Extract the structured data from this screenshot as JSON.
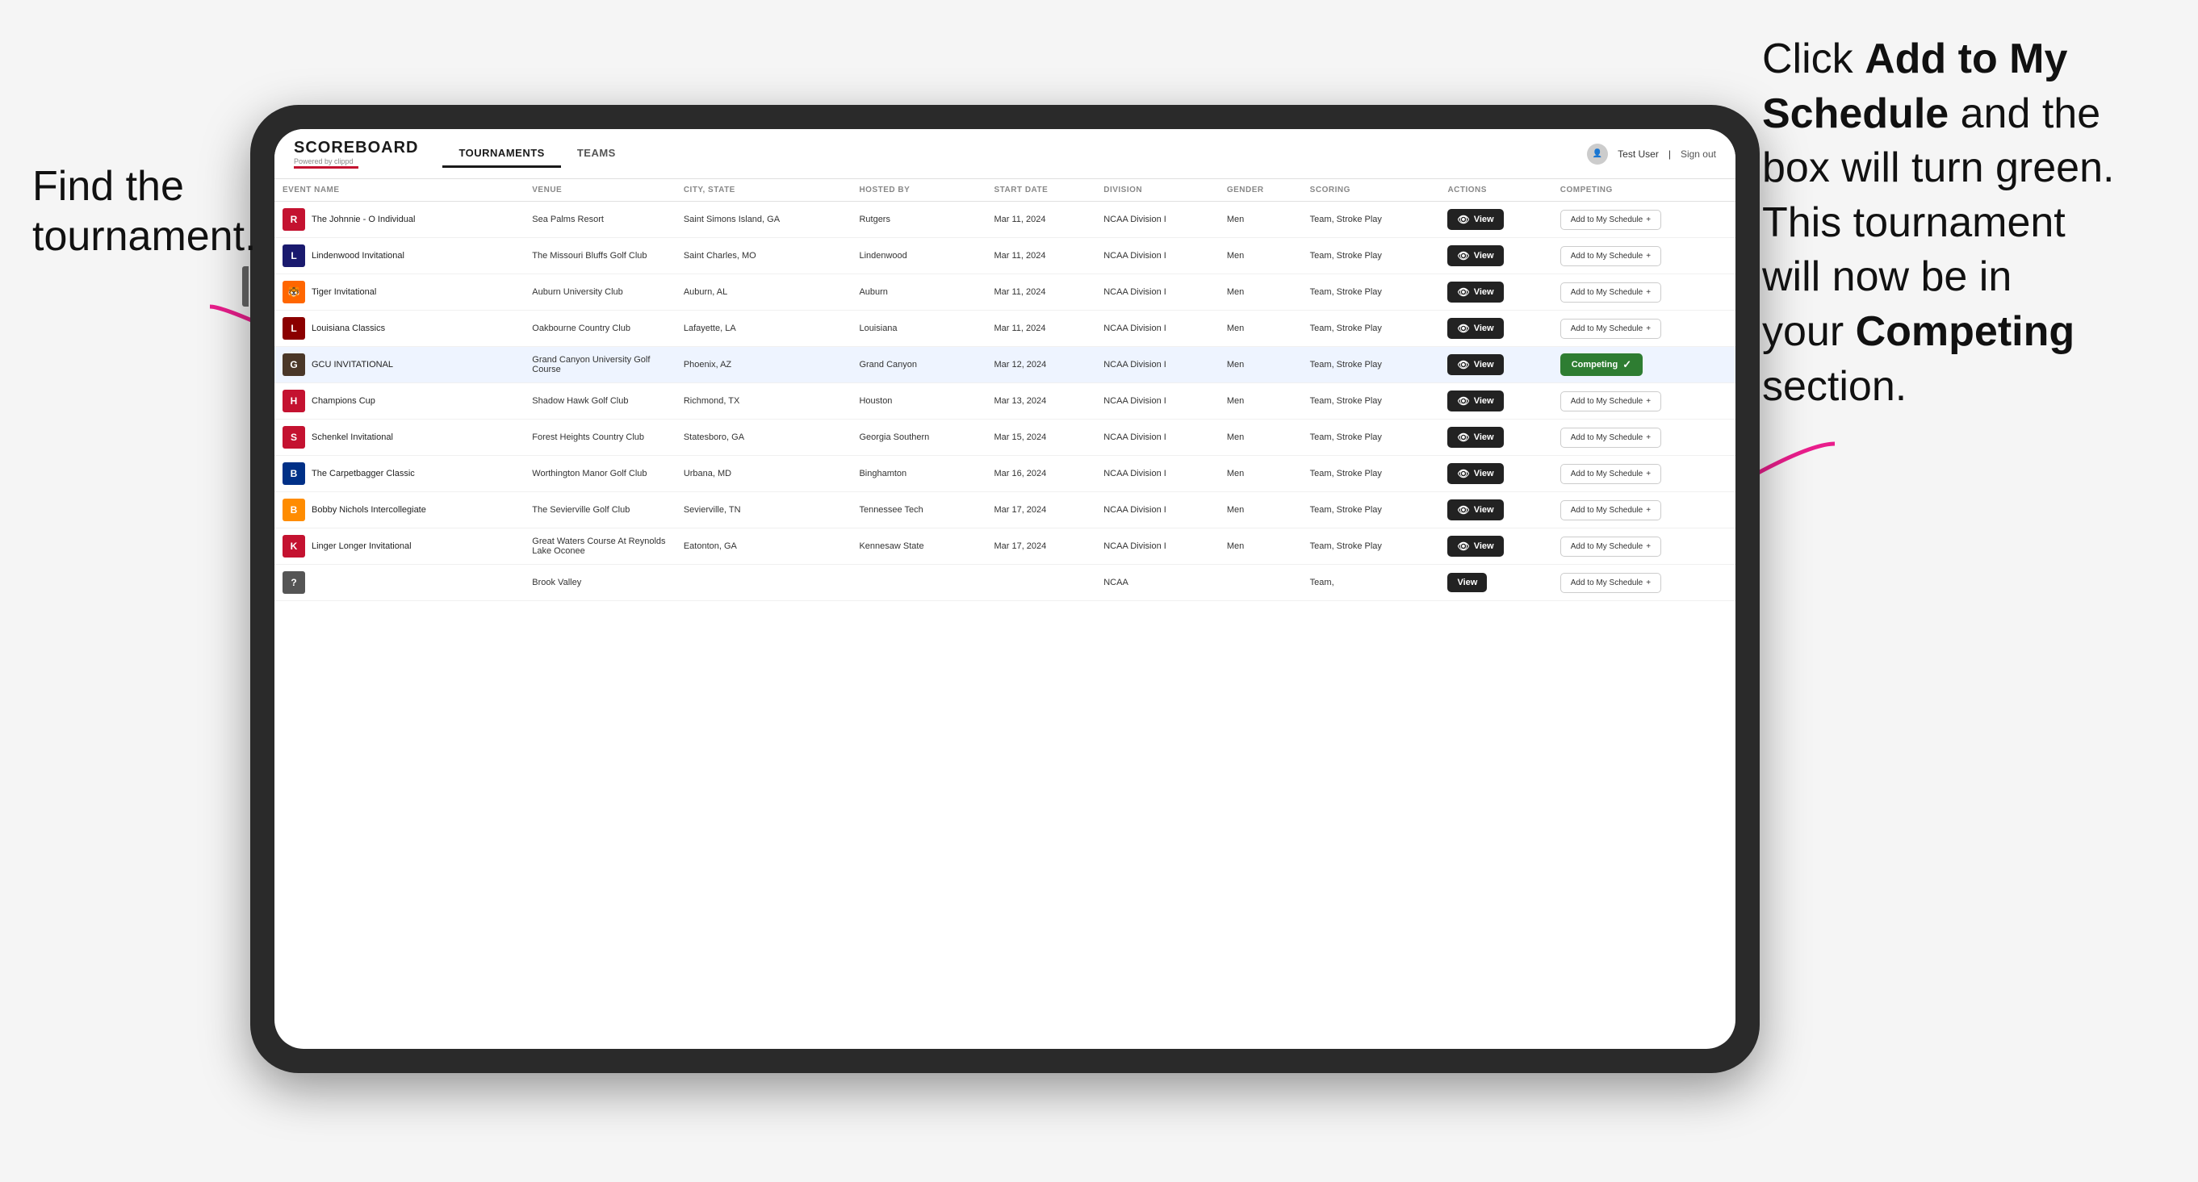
{
  "annotations": {
    "left": "Find the\ntournament.",
    "right_line1": "Click ",
    "right_bold1": "Add to My\nSchedule",
    "right_line2": " and the\nbox will turn green.\nThis tournament\nwill now be in\nyour ",
    "right_bold2": "Competing",
    "right_line3": "\nsection."
  },
  "header": {
    "logo": "SCOREBOARD",
    "logo_sub": "Powered by clippd",
    "nav_tabs": [
      "TOURNAMENTS",
      "TEAMS"
    ],
    "active_tab": "TOURNAMENTS",
    "user_text": "Test User",
    "sign_out": "Sign out"
  },
  "table": {
    "columns": [
      "EVENT NAME",
      "VENUE",
      "CITY, STATE",
      "HOSTED BY",
      "START DATE",
      "DIVISION",
      "GENDER",
      "SCORING",
      "ACTIONS",
      "COMPETING"
    ],
    "rows": [
      {
        "logo_color": "#c41230",
        "logo_letter": "R",
        "event": "The Johnnie - O Individual",
        "venue": "Sea Palms Resort",
        "city_state": "Saint Simons Island, GA",
        "hosted_by": "Rutgers",
        "start_date": "Mar 11, 2024",
        "division": "NCAA Division I",
        "gender": "Men",
        "scoring": "Team, Stroke Play",
        "competing": false,
        "highlighted": false
      },
      {
        "logo_color": "#1a1a6e",
        "logo_letter": "L",
        "event": "Lindenwood Invitational",
        "venue": "The Missouri Bluffs Golf Club",
        "city_state": "Saint Charles, MO",
        "hosted_by": "Lindenwood",
        "start_date": "Mar 11, 2024",
        "division": "NCAA Division I",
        "gender": "Men",
        "scoring": "Team, Stroke Play",
        "competing": false,
        "highlighted": false
      },
      {
        "logo_color": "#FF6600",
        "logo_letter": "🐯",
        "event": "Tiger Invitational",
        "venue": "Auburn University Club",
        "city_state": "Auburn, AL",
        "hosted_by": "Auburn",
        "start_date": "Mar 11, 2024",
        "division": "NCAA Division I",
        "gender": "Men",
        "scoring": "Team, Stroke Play",
        "competing": false,
        "highlighted": false
      },
      {
        "logo_color": "#8B0000",
        "logo_letter": "L",
        "event": "Louisiana Classics",
        "venue": "Oakbourne Country Club",
        "city_state": "Lafayette, LA",
        "hosted_by": "Louisiana",
        "start_date": "Mar 11, 2024",
        "division": "NCAA Division I",
        "gender": "Men",
        "scoring": "Team, Stroke Play",
        "competing": false,
        "highlighted": false
      },
      {
        "logo_color": "#4a3728",
        "logo_letter": "G",
        "event": "GCU INVITATIONAL",
        "venue": "Grand Canyon University Golf Course",
        "city_state": "Phoenix, AZ",
        "hosted_by": "Grand Canyon",
        "start_date": "Mar 12, 2024",
        "division": "NCAA Division I",
        "gender": "Men",
        "scoring": "Team, Stroke Play",
        "competing": true,
        "highlighted": true
      },
      {
        "logo_color": "#c41230",
        "logo_letter": "H",
        "event": "Champions Cup",
        "venue": "Shadow Hawk Golf Club",
        "city_state": "Richmond, TX",
        "hosted_by": "Houston",
        "start_date": "Mar 13, 2024",
        "division": "NCAA Division I",
        "gender": "Men",
        "scoring": "Team, Stroke Play",
        "competing": false,
        "highlighted": false
      },
      {
        "logo_color": "#c41230",
        "logo_letter": "S",
        "event": "Schenkel Invitational",
        "venue": "Forest Heights Country Club",
        "city_state": "Statesboro, GA",
        "hosted_by": "Georgia Southern",
        "start_date": "Mar 15, 2024",
        "division": "NCAA Division I",
        "gender": "Men",
        "scoring": "Team, Stroke Play",
        "competing": false,
        "highlighted": false
      },
      {
        "logo_color": "#003087",
        "logo_letter": "B",
        "event": "The Carpetbagger Classic",
        "venue": "Worthington Manor Golf Club",
        "city_state": "Urbana, MD",
        "hosted_by": "Binghamton",
        "start_date": "Mar 16, 2024",
        "division": "NCAA Division I",
        "gender": "Men",
        "scoring": "Team, Stroke Play",
        "competing": false,
        "highlighted": false
      },
      {
        "logo_color": "#FF8C00",
        "logo_letter": "B",
        "event": "Bobby Nichols Intercollegiate",
        "venue": "The Sevierville Golf Club",
        "city_state": "Sevierville, TN",
        "hosted_by": "Tennessee Tech",
        "start_date": "Mar 17, 2024",
        "division": "NCAA Division I",
        "gender": "Men",
        "scoring": "Team, Stroke Play",
        "competing": false,
        "highlighted": false
      },
      {
        "logo_color": "#c41230",
        "logo_letter": "K",
        "event": "Linger Longer Invitational",
        "venue": "Great Waters Course At Reynolds Lake Oconee",
        "city_state": "Eatonton, GA",
        "hosted_by": "Kennesaw State",
        "start_date": "Mar 17, 2024",
        "division": "NCAA Division I",
        "gender": "Men",
        "scoring": "Team, Stroke Play",
        "competing": false,
        "highlighted": false
      },
      {
        "logo_color": "#555",
        "logo_letter": "?",
        "event": "",
        "venue": "Brook Valley",
        "city_state": "",
        "hosted_by": "",
        "start_date": "",
        "division": "NCAA",
        "gender": "",
        "scoring": "Team,",
        "competing": false,
        "highlighted": false,
        "partial": true
      }
    ],
    "competing_label": "Competing",
    "add_schedule_label": "Add to My Schedule",
    "view_label": "View"
  }
}
